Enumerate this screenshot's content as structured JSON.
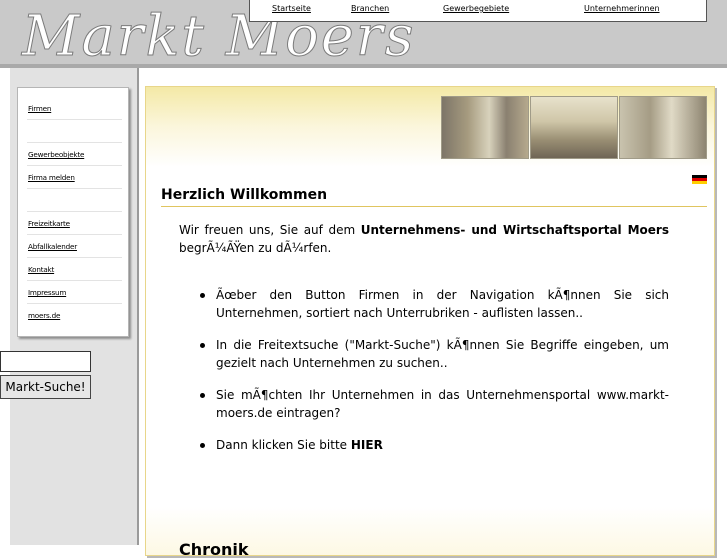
{
  "header": {
    "logo_text": "Markt Moers",
    "nav": [
      "Startseite",
      "Branchen",
      "Gewerbegebiete",
      "Unternehmerinnen"
    ]
  },
  "sidebar": {
    "items": [
      "Firmen",
      "",
      "Gewerbeobjekte",
      "Firma melden",
      "",
      "Freizeitkarte",
      "Abfallkalender",
      "Kontakt",
      "Impressum",
      "moers.de"
    ]
  },
  "search": {
    "input_value": "",
    "button_label": "Markt-Suche!"
  },
  "main": {
    "title": "Herzlich Willkommen",
    "intro_before": "Wir freuen uns, Sie auf dem ",
    "intro_bold": "Unternehmens- und Wirtschaftsportal Moers",
    "intro_after": " begrÃ¼ÃŸen zu dÃ¼rfen.",
    "bullets": [
      "Ãœber den Button Firmen in der Navigation kÃ¶nnen Sie sich Unternehmen, sortiert nach Unterrubriken - auflisten lassen..",
      "In die Freitextsuche (\"Markt-Suche\") kÃ¶nnen Sie Begriffe eingeben, um gezielt nach Unternehmen zu suchen..",
      "Sie mÃ¶chten Ihr Unternehmen in das Unternehmensportal www.markt-moers.de eintragen?"
    ],
    "last_bullet_text": "Dann klicken Sie bitte ",
    "last_bullet_link": "HIER",
    "next_heading": "Chronik"
  }
}
